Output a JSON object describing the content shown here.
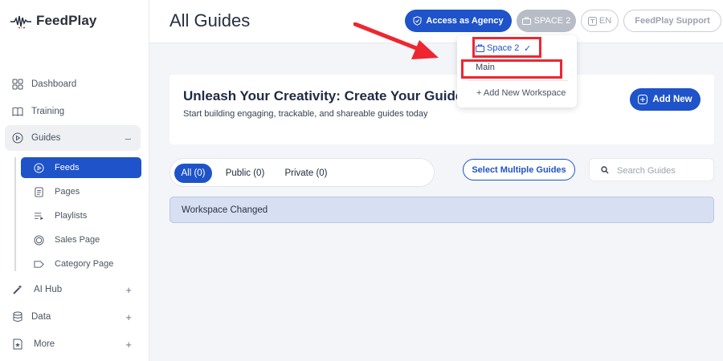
{
  "app": {
    "name": "FeedPlay"
  },
  "sidebar": {
    "items": [
      {
        "label": "Dashboard",
        "icon": "grid-icon"
      },
      {
        "label": "Training",
        "icon": "book-icon"
      },
      {
        "label": "Guides",
        "icon": "play-circle-icon",
        "toggle": "–"
      },
      {
        "label": "AI Hub",
        "icon": "magic-wand-icon",
        "toggle": "+"
      },
      {
        "label": "Data",
        "icon": "database-icon",
        "toggle": "+"
      },
      {
        "label": "More",
        "icon": "star-box-icon",
        "toggle": "+"
      }
    ],
    "guides_sub": [
      {
        "label": "Feeds",
        "icon": "play-circle-icon",
        "active": true
      },
      {
        "label": "Pages",
        "icon": "page-icon"
      },
      {
        "label": "Playlists",
        "icon": "playlist-icon"
      },
      {
        "label": "Sales Page",
        "icon": "coin-icon"
      },
      {
        "label": "Category Page",
        "icon": "tag-icon"
      }
    ]
  },
  "header": {
    "title": "All Guides",
    "agency_label": "Access as Agency",
    "space_label": "SPACE 2",
    "lang_label": "EN",
    "support_label": "FeedPlay Support"
  },
  "dropdown": {
    "current": "Space 2",
    "check": "✓",
    "other": "Main",
    "add": "+ Add New Workspace"
  },
  "banner": {
    "title": "Unleash Your Creativity: Create Your Guides",
    "subtitle": "Start building engaging, trackable, and shareable guides today",
    "add_label": "Add New"
  },
  "filters": {
    "all": "All (0)",
    "public": "Public (0)",
    "private": "Private (0)"
  },
  "select_multiple_label": "Select Multiple Guides",
  "search": {
    "placeholder": "Search Guides"
  },
  "notice": "Workspace Changed",
  "colors": {
    "primary": "#1e53c9",
    "highlight": "#ee2630",
    "notice_bg": "#d7e0f3"
  }
}
